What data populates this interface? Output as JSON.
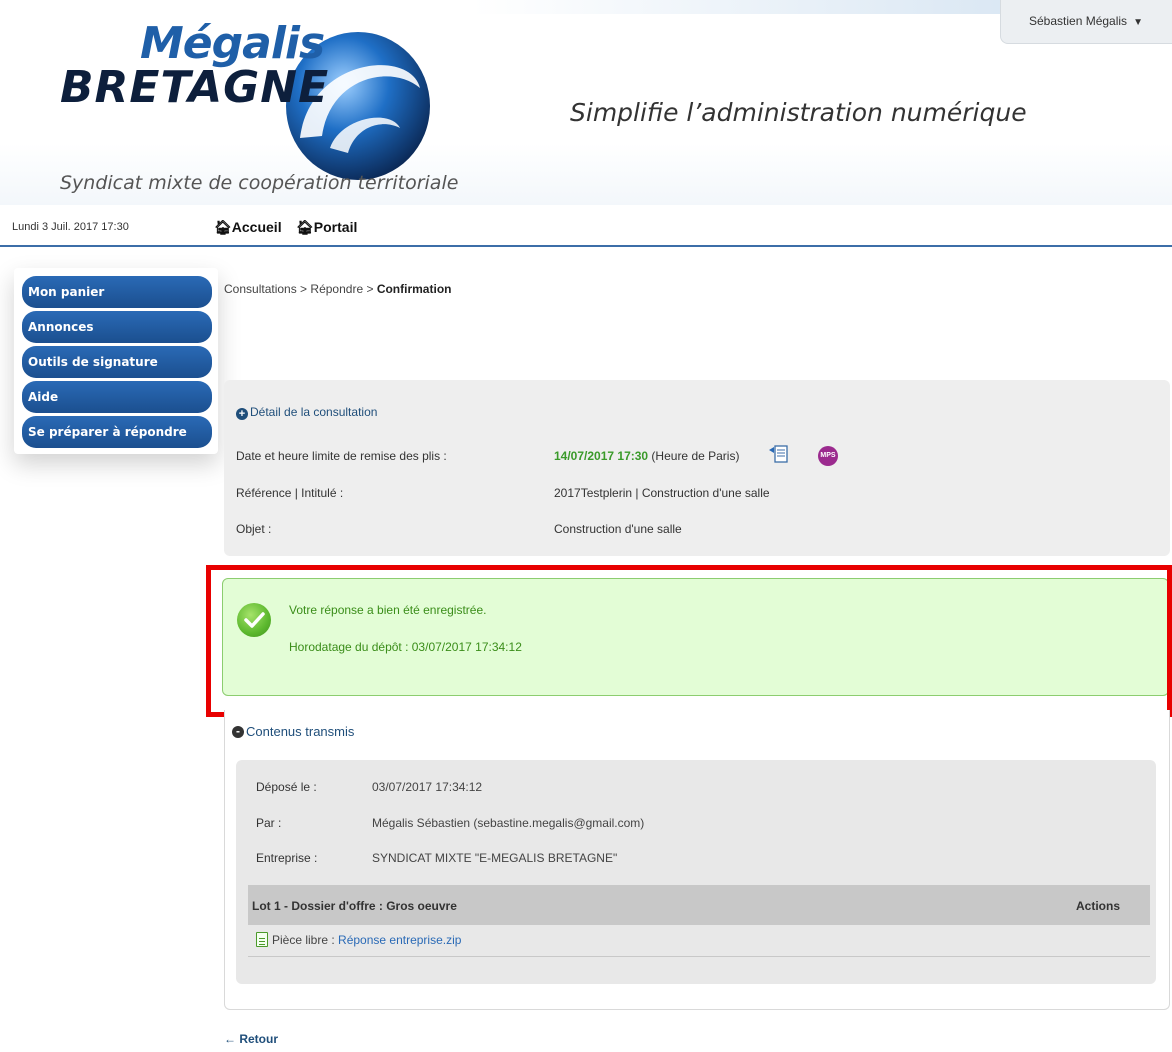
{
  "header": {
    "logo_top": "Mégalis",
    "logo_bottom": "BRETAGNE",
    "slogan": "Simplifie l’administration numérique",
    "tagline": "Syndicat mixte de coopération territoriale",
    "user_name": "Sébastien Mégalis",
    "user_caret": "▼"
  },
  "topbar": {
    "date": "Lundi 3 Juil. 2017 17:30",
    "accueil": "Accueil",
    "portail": "Portail",
    "home_icon": "home-icon"
  },
  "sidebar": {
    "items": [
      {
        "label": "Mon panier"
      },
      {
        "label": "Annonces"
      },
      {
        "label": "Outils de signature"
      },
      {
        "label": "Aide"
      },
      {
        "label": "Se préparer à répondre"
      }
    ]
  },
  "breadcrumb": {
    "part1": "Consultations",
    "sep1": " > ",
    "part2": "Répondre",
    "sep2": " > ",
    "current": "Confirmation"
  },
  "detail": {
    "title": "Détail de la consultation",
    "date_label": "Date et heure limite de remise des plis :",
    "date_value": "14/07/2017 17:30",
    "date_suffix": " (Heure de Paris)",
    "reference_label": "Référence | Intitulé :",
    "reference_value": "2017Testplerin | Construction d'une salle",
    "objet_label": "Objet :",
    "objet_value": "Construction d'une salle",
    "mps_badge": "MPS",
    "deadline_color": "#3a9a2a"
  },
  "success": {
    "message": "Votre réponse a bien été enregistrée.",
    "timestamp": "Horodatage du dépôt :  03/07/2017 17:34:12"
  },
  "contenus": {
    "title": "Contenus transmis",
    "depose_label": "Déposé le :",
    "depose_value": "03/07/2017 17:34:12",
    "par_label": "Par :",
    "par_value": "Mégalis Sébastien (sebastine.megalis@gmail.com)",
    "entreprise_label": "Entreprise :",
    "entreprise_value": "SYNDICAT MIXTE \"E-MEGALIS BRETAGNE\"",
    "lot_title": "Lot 1 - Dossier d'offre : Gros oeuvre",
    "actions_label": "Actions",
    "file_prefix": "Pièce libre : ",
    "file_name": "Réponse entreprise.zip"
  },
  "footer": {
    "retour": "Retour",
    "retour_arrow": "←"
  },
  "colors": {
    "brand_blue": "#1f5fa8",
    "sidebar_blue": "#1b4f8f",
    "success_bg": "#e3fdd6",
    "highlight_red": "#e80000"
  }
}
